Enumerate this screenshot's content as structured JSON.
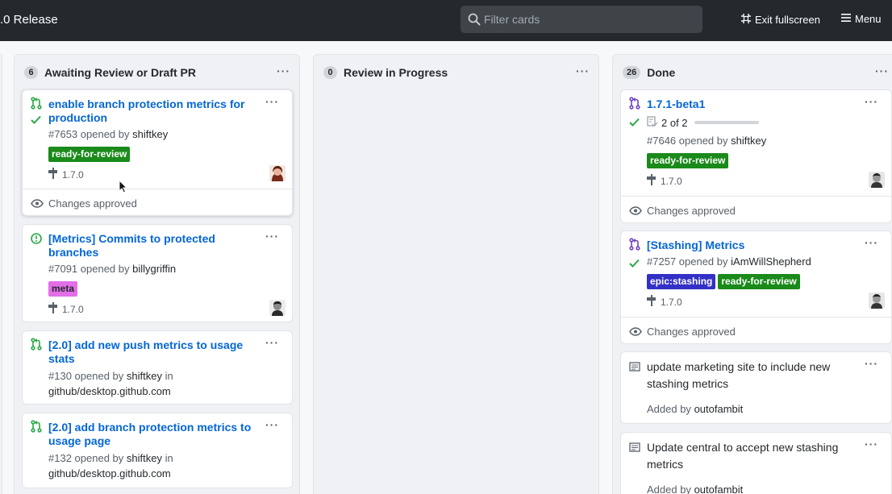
{
  "topbar": {
    "title": ".0 Release",
    "search_placeholder": "Filter cards",
    "exit_label": "Exit fullscreen",
    "menu_label": "Menu",
    "icons": [
      "search-icon",
      "screen-normal-icon",
      "hamburger-icon"
    ]
  },
  "colors": {
    "topbar_bg": "#24292e",
    "link": "#0366d6",
    "open_pr": "#28a745",
    "merged_pr": "#6f42c1",
    "label_ready": "#1a8a1a",
    "label_meta": "#e46ee8",
    "label_epic": "#3330c6"
  },
  "columns": [
    {
      "count": "6",
      "title": "Awaiting Review or Draft PR",
      "cards": [
        {
          "title": "enable branch protection metrics for production",
          "number": "#7653",
          "opened_by": "opened by",
          "author": "shiftkey",
          "labels": [
            "ready-for-review"
          ],
          "milestone": "1.7.0",
          "footer": "Changes approved"
        },
        {
          "title": "[Metrics] Commits to protected branches",
          "number": "#7091",
          "opened_by": "opened by",
          "author": "billygriffin",
          "labels": [
            "meta"
          ],
          "milestone": "1.7.0"
        },
        {
          "title": "[2.0] add new push metrics to usage stats",
          "number": "#130",
          "opened_by": "opened by",
          "author": "shiftkey",
          "in": "in",
          "repo": "github/desktop.github.com"
        },
        {
          "title": "[2.0] add branch protection metrics to usage page",
          "number": "#132",
          "opened_by": "opened by",
          "author": "shiftkey",
          "in": "in",
          "repo": "github/desktop.github.com"
        }
      ]
    },
    {
      "count": "0",
      "title": "Review in Progress",
      "cards": []
    },
    {
      "count": "26",
      "title": "Done",
      "cards": [
        {
          "title": "1.7.1-beta1",
          "progress": "2 of 2",
          "number": "#7646",
          "opened_by": "opened by",
          "author": "shiftkey",
          "labels": [
            "ready-for-review"
          ],
          "milestone": "1.7.0",
          "footer": "Changes approved"
        },
        {
          "title": "[Stashing] Metrics",
          "number": "#7257",
          "opened_by": "opened by",
          "author": "iAmWillShepherd",
          "labels": [
            "epic:stashing",
            "ready-for-review"
          ],
          "milestone": "1.7.0",
          "footer": "Changes approved"
        },
        {
          "title": "update marketing site to include new stashing metrics",
          "added_by": "Added by",
          "author": "outofambit"
        },
        {
          "title": "Update central to accept new stashing metrics",
          "added_by": "Added by",
          "author": "outofambit"
        }
      ]
    }
  ],
  "dots": "···"
}
